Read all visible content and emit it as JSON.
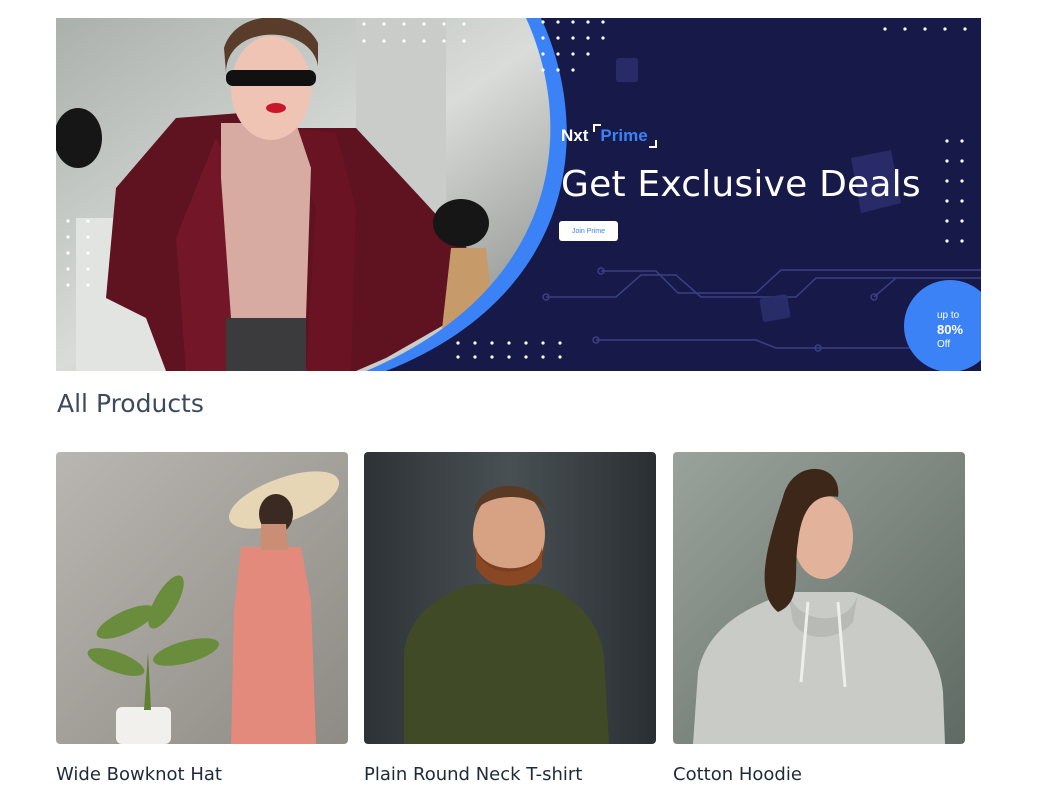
{
  "banner": {
    "brand_main": "Nxt",
    "brand_accent": "Prime",
    "headline": "Get Exclusive Deals",
    "cta_label": "Join Prime",
    "offer": {
      "pre": "up to",
      "value": "80%",
      "post": "Off"
    },
    "colors": {
      "background": "#171a48",
      "accent": "#3b82f6"
    }
  },
  "section": {
    "title": "All Products"
  },
  "products": [
    {
      "title": "Wide Bowknot Hat",
      "image": "woman-in-pink-dress-photo"
    },
    {
      "title": "Plain Round Neck T-shirt",
      "image": "bearded-man-olive-tee-photo"
    },
    {
      "title": "Cotton Hoodie",
      "image": "man-grey-hoodie-photo"
    }
  ]
}
